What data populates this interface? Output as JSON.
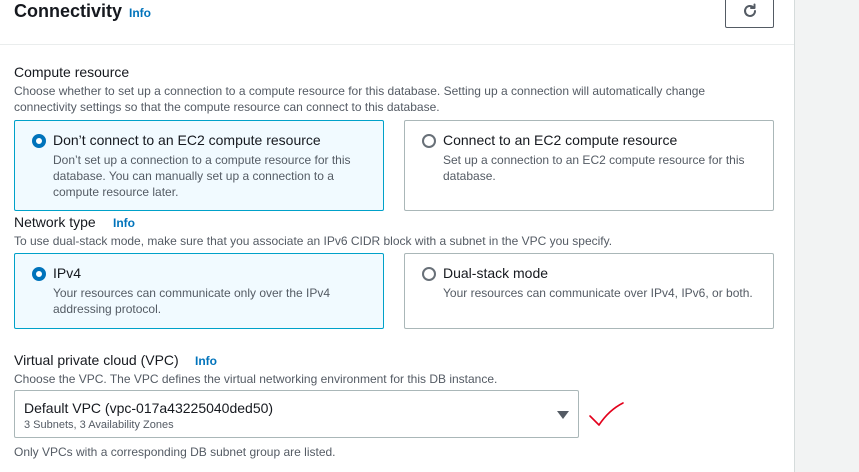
{
  "header": {
    "title": "Connectivity",
    "info": "Info",
    "refresh_icon": "refresh-icon"
  },
  "compute": {
    "label": "Compute resource",
    "description_line1": "Choose whether to set up a connection to a compute resource for this database. Setting up a connection will automatically change",
    "description_line2": "connectivity settings so that the compute resource can connect to this database.",
    "options": [
      {
        "title": "Don’t connect to an EC2 compute resource",
        "desc_lines": [
          "Don’t set up a connection to a compute resource for this",
          "database. You can manually set up a connection to a",
          "compute resource later."
        ],
        "selected": true
      },
      {
        "title": "Connect to an EC2 compute resource",
        "desc_lines": [
          "Set up a connection to an EC2 compute resource for this",
          "database."
        ],
        "selected": false
      }
    ]
  },
  "network": {
    "label": "Network type",
    "info": "Info",
    "description": "To use dual-stack mode, make sure that you associate an IPv6 CIDR block with a subnet in the VPC you specify.",
    "options": [
      {
        "title": "IPv4",
        "desc_lines": [
          "Your resources can communicate only over the IPv4",
          "addressing protocol."
        ],
        "selected": true
      },
      {
        "title": "Dual-stack mode",
        "desc_lines": [
          "Your resources can communicate over IPv4, IPv6, or both."
        ],
        "selected": false
      }
    ]
  },
  "vpc": {
    "label": "Virtual private cloud (VPC)",
    "info": "Info",
    "description": "Choose the VPC. The VPC defines the virtual networking environment for this DB instance.",
    "selected_value": "Default VPC (vpc-017a43225040ded50)",
    "selected_sub": "3 Subnets, 3 Availability Zones",
    "footnote": "Only VPCs with a corresponding DB subnet group are listed."
  },
  "colors": {
    "accent": "#0073bb",
    "selected_border": "#00a1c9",
    "selected_bg": "#f1faff",
    "annotation": "#e3001b"
  }
}
